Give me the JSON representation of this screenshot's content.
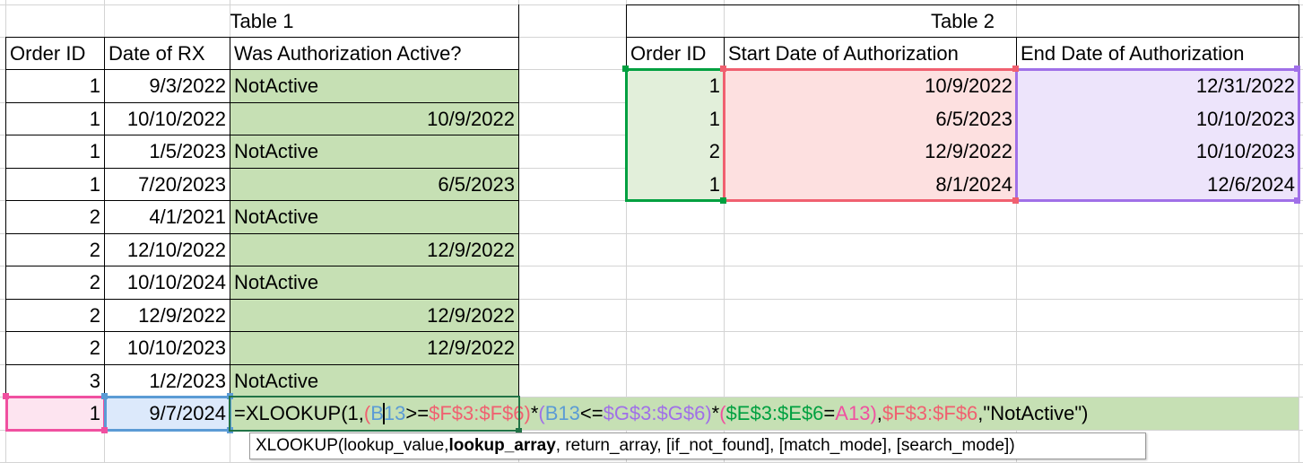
{
  "colors": {
    "green_fill": "#c6e0b4",
    "green_ref": "#00a040",
    "red_ref": "#f06070",
    "purple_ref": "#a070e8",
    "pink_ref": "#f050a0",
    "blue_ref": "#5b9bd5"
  },
  "table1": {
    "title": "Table 1",
    "headers": [
      "Order ID",
      "Date of RX",
      "Was Authorization Active?"
    ],
    "rows": [
      [
        "1",
        "9/3/2022",
        "NotActive"
      ],
      [
        "1",
        "10/10/2022",
        "10/9/2022"
      ],
      [
        "1",
        "1/5/2023",
        "NotActive"
      ],
      [
        "1",
        "7/20/2023",
        "6/5/2023"
      ],
      [
        "2",
        "4/1/2021",
        "NotActive"
      ],
      [
        "2",
        "12/10/2022",
        "12/9/2022"
      ],
      [
        "2",
        "10/10/2024",
        "NotActive"
      ],
      [
        "2",
        "12/9/2022",
        "12/9/2022"
      ],
      [
        "2",
        "10/10/2023",
        "12/9/2022"
      ],
      [
        "3",
        "1/2/2023",
        "NotActive"
      ]
    ],
    "edit_row": {
      "order_id": "1",
      "date": "9/7/2024",
      "formula_parts": [
        "=XLOOKUP(1,",
        "(",
        "B",
        "13",
        ">=",
        "$F$3:$F$6",
        ")",
        "*",
        "(",
        "B13",
        "<=",
        "$G$3:$G$6",
        ")",
        "*",
        "(",
        "$E$3:$E$6",
        "=",
        "A13",
        ")",
        ",",
        "$F$3:$F$6",
        ",\"NotActive\")"
      ]
    }
  },
  "table2": {
    "title": "Table 2",
    "headers": [
      "Order ID",
      "Start Date of Authorization",
      "End Date of Authorization"
    ],
    "rows": [
      [
        "1",
        "10/9/2022",
        "12/31/2022"
      ],
      [
        "1",
        "6/5/2023",
        "10/10/2023"
      ],
      [
        "2",
        "12/9/2022",
        "10/10/2023"
      ],
      [
        "1",
        "8/1/2024",
        "12/6/2024"
      ]
    ]
  },
  "tooltip": {
    "fn": "XLOOKUP(",
    "arg1": "lookup_value, ",
    "arg2": "lookup_array",
    "rest": ", return_array, [if_not_found], [match_mode], [search_mode])"
  }
}
